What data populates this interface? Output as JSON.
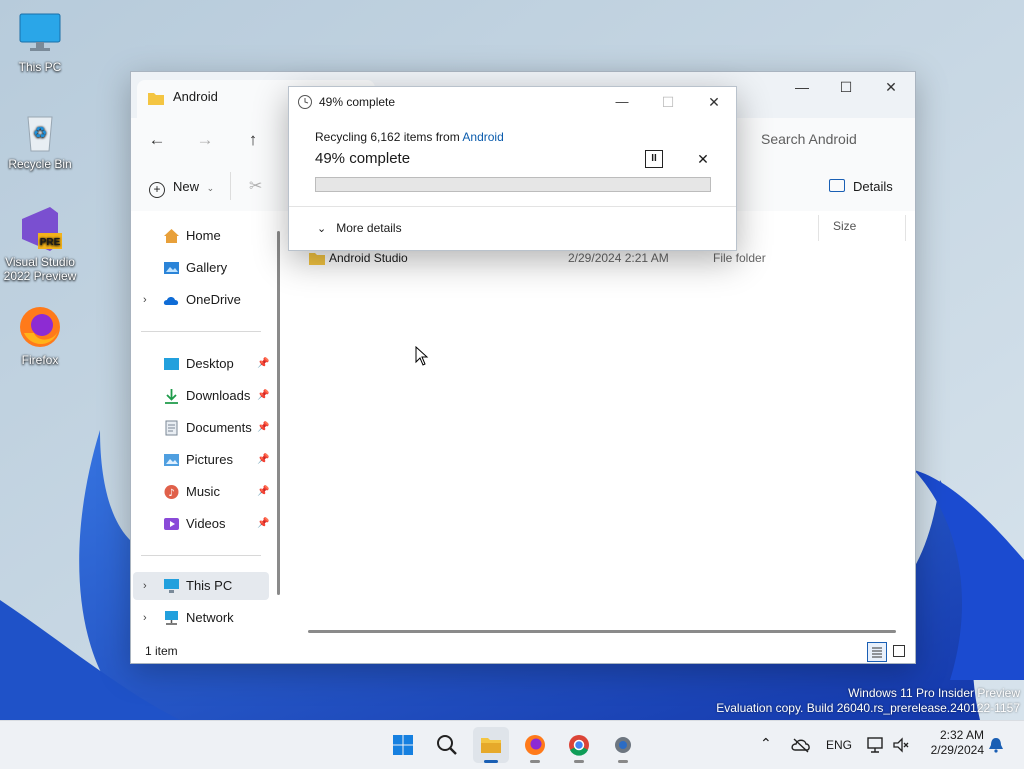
{
  "desktop": {
    "icons": [
      {
        "label": "This PC"
      },
      {
        "label": "Recycle Bin"
      },
      {
        "label": "Visual Studio 2022 Preview",
        "badge": "PRE"
      },
      {
        "label": "Firefox"
      }
    ],
    "watermark": {
      "line1": "Windows 11 Pro Insider Preview",
      "line2": "Evaluation copy. Build 26040.rs_prerelease.240122-1157"
    }
  },
  "explorer": {
    "tab_title": "Android",
    "search_placeholder": "Search Android",
    "new_label": "New",
    "details_label": "Details",
    "nav": {
      "home": "Home",
      "gallery": "Gallery",
      "onedrive": "OneDrive",
      "desktop": "Desktop",
      "downloads": "Downloads",
      "documents": "Documents",
      "pictures": "Pictures",
      "music": "Music",
      "videos": "Videos",
      "thispc": "This PC",
      "network": "Network"
    },
    "columns": {
      "size": "Size"
    },
    "files": [
      {
        "name": "Android Studio",
        "date": "2/29/2024 2:21 AM",
        "type": "File folder"
      }
    ],
    "status": "1 item"
  },
  "dialog": {
    "title": "49% complete",
    "recycling_prefix": "Recycling 6,162 items from ",
    "source": "Android",
    "percent_text": "49% complete",
    "progress_fraction": 0.49,
    "more_details": "More details"
  },
  "taskbar": {
    "lang": "ENG",
    "time": "2:32 AM",
    "date": "2/29/2024"
  },
  "colors": {
    "accent": "#0b5cad",
    "folder": "#f4c542"
  }
}
